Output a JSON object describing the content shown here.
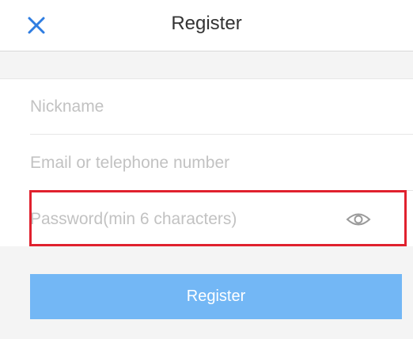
{
  "header": {
    "title": "Register",
    "close_icon": "close-icon"
  },
  "form": {
    "nickname_placeholder": "Nickname",
    "nickname_value": "",
    "contact_placeholder": "Email or telephone number",
    "contact_value": "",
    "password_placeholder": "Password(min 6 characters)",
    "password_value": "",
    "password_toggle_icon": "eye-icon"
  },
  "actions": {
    "register_label": "Register"
  },
  "colors": {
    "accent": "#2f7de1",
    "button": "#73b7f5",
    "highlight": "#e0212e"
  }
}
